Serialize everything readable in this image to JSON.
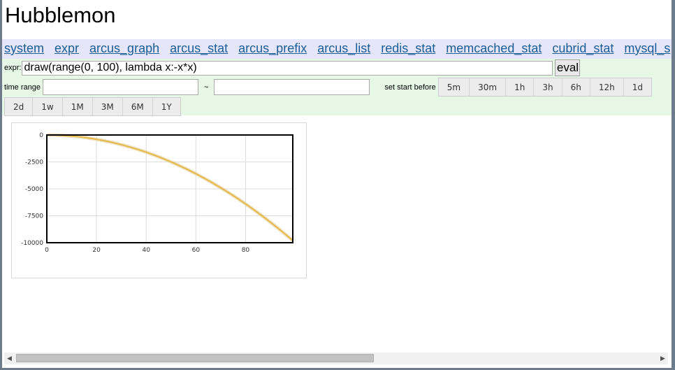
{
  "app": {
    "title": "Hubblemon"
  },
  "nav": {
    "items": [
      "system",
      "expr",
      "arcus_graph",
      "arcus_stat",
      "arcus_prefix",
      "arcus_list",
      "redis_stat",
      "memcached_stat",
      "cubrid_stat",
      "mysql_s"
    ]
  },
  "controls": {
    "expr_label": "expr:",
    "expr_value": "draw(range(0, 100), lambda x:-x*x)",
    "eval_label": "eval",
    "time_range_label": "time range",
    "range_separator": "~",
    "start_from_value": "",
    "start_to_value": "",
    "set_start_before_label": "set start before",
    "periods_row1": [
      "5m",
      "30m",
      "1h",
      "3h",
      "6h",
      "12h",
      "1d"
    ],
    "periods_row2": [
      "2d",
      "1w",
      "1M",
      "3M",
      "6M",
      "1Y"
    ]
  },
  "chart_data": {
    "type": "line",
    "xlim": [
      0,
      99
    ],
    "ylim": [
      -10000,
      0
    ],
    "x_ticks": [
      0,
      20,
      40,
      60,
      80
    ],
    "y_ticks": [
      0,
      -2500,
      -5000,
      -7500,
      -10000
    ],
    "grid": true,
    "series": [
      {
        "color": "#e6b84a",
        "x": [
          0,
          10,
          20,
          30,
          40,
          50,
          60,
          70,
          80,
          90,
          99
        ],
        "y": [
          0,
          -100,
          -400,
          -900,
          -1600,
          -2500,
          -3600,
          -4900,
          -6400,
          -8100,
          -9801
        ]
      }
    ]
  }
}
